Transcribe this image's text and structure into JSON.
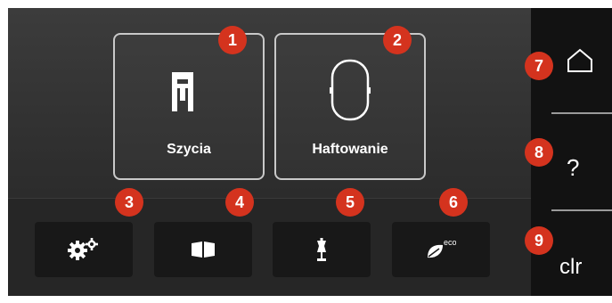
{
  "mode_tiles": [
    {
      "label": "Szycia",
      "badge": "1",
      "icon": "presser-foot-icon"
    },
    {
      "label": "Haftowanie",
      "badge": "2",
      "icon": "embroidery-hoop-icon"
    }
  ],
  "toolbar": [
    {
      "badge": "3",
      "icon": "settings-gears-icon"
    },
    {
      "badge": "4",
      "icon": "book-icon"
    },
    {
      "badge": "5",
      "icon": "dress-form-icon"
    },
    {
      "badge": "6",
      "icon": "eco-leaf-icon",
      "icon_text": "eco"
    }
  ],
  "right_panel": {
    "home": {
      "badge": "7",
      "icon": "home-icon"
    },
    "help": {
      "badge": "8",
      "label": "?"
    },
    "clear": {
      "badge": "9",
      "label": "clr"
    }
  },
  "colors": {
    "badge": "#d4331e",
    "background": "#1e1e1e",
    "tile_border": "#c9c9c9"
  }
}
